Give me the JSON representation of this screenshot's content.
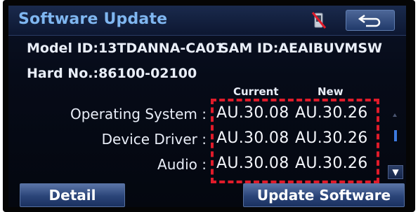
{
  "header": {
    "title": "Software Update",
    "icons": {
      "phone": "phone-disconnected-icon",
      "back": "back-arrow-icon"
    }
  },
  "device_info": {
    "model_id": "Model ID:13TDANNA-CA01",
    "sam_id": "SAM ID:AEAIBUVMSW",
    "hard_no": "Hard No.:86100-02100"
  },
  "columns": {
    "current": "Current",
    "new": "New"
  },
  "rows": [
    {
      "label": "Operating System :",
      "current": "AU.30.08",
      "new": "AU.30.26"
    },
    {
      "label": "Device Driver :",
      "current": "AU.30.08",
      "new": "AU.30.26"
    },
    {
      "label": "Audio :",
      "current": "AU.30.08",
      "new": "AU.30.26"
    }
  ],
  "scroll": {
    "down_glyph": "▼"
  },
  "buttons": {
    "detail": "Detail",
    "update": "Update Software"
  },
  "colors": {
    "highlight": "#e01b2a",
    "title": "#7fb6f0",
    "accent": "#3c7ae0"
  }
}
